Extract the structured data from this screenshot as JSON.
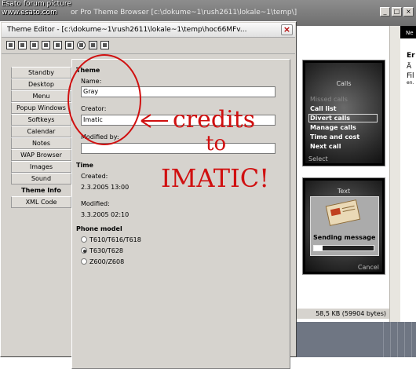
{
  "watermark": {
    "line1": "Esato forum picture",
    "line2": "www.esato.com"
  },
  "background_window": {
    "title": "or Pro    Theme Browser    [c:\\dokume~1\\rush2611\\lokale~1\\temp\\]",
    "buttons": [
      "_",
      "□",
      "×"
    ],
    "right_fragments": [
      "Ne",
      "Er",
      "Ä",
      "Fil",
      "en."
    ]
  },
  "dialog": {
    "title": "Theme Editor - [c:\\dokume~1\\rush2611\\lokale~1\\temp\\hoc66MFv...",
    "close_label": "×"
  },
  "nav": {
    "items": [
      "Standby",
      "Desktop",
      "Menu",
      "Popup Windows",
      "Softkeys",
      "Calendar",
      "Notes",
      "WAP Browser",
      "Images",
      "Sound",
      "Theme Info",
      "XML Code"
    ],
    "active": "Theme Info"
  },
  "theme": {
    "heading": "Theme",
    "name_label": "Name:",
    "name_value": "Gray",
    "creator_label": "Creator:",
    "creator_value": "Imatic",
    "modified_by_label": "Modified by:",
    "modified_by_value": ""
  },
  "time": {
    "heading": "Time",
    "created_label": "Created:",
    "created_value": "2.3.2005 13:00",
    "modified_label": "Modified:",
    "modified_value": "3.3.2005 02:10"
  },
  "phone_model": {
    "heading": "Phone model",
    "options": [
      "T610/T616/T618",
      "T630/T628",
      "Z600/Z608"
    ],
    "selected": "T630/T628"
  },
  "preview1": {
    "title": "Calls",
    "items": [
      "Missed calls",
      "Call list",
      "Divert calls",
      "Manage calls",
      "Time and cost",
      "Next call"
    ],
    "selected": "Divert calls",
    "softkey": "Select"
  },
  "preview2": {
    "title": "Text",
    "message": "Sending message",
    "softkey": "Cancel",
    "progress": 0.15
  },
  "status": {
    "size": "58,5 KB (59904 bytes)"
  },
  "annotations": {
    "line1": "credits",
    "line2": "to",
    "line3": "IMATIC!"
  },
  "colors": {
    "annotation": "#d01010",
    "dialog_bg": "#d6d3ce"
  }
}
